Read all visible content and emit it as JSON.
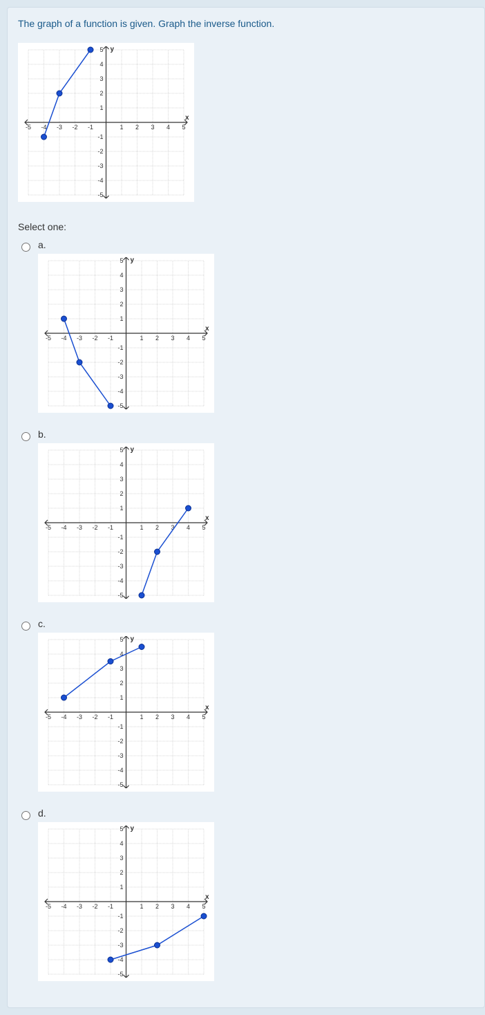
{
  "question": "The graph of a function is given. Graph the inverse function.",
  "select_label": "Select one:",
  "options": {
    "a": "a.",
    "b": "b.",
    "c": "c.",
    "d": "d."
  },
  "chart_data": [
    {
      "type": "line",
      "name": "given",
      "x": [
        -4,
        -3,
        -1
      ],
      "y": [
        -1,
        2,
        5
      ],
      "xlim": [
        -5,
        5
      ],
      "ylim": [
        -5,
        5
      ],
      "xlabel": "x",
      "ylabel": "y"
    },
    {
      "type": "line",
      "name": "option_a",
      "x": [
        -4,
        -3,
        -1
      ],
      "y": [
        1,
        -2,
        -5
      ],
      "xlim": [
        -5,
        5
      ],
      "ylim": [
        -5,
        5
      ],
      "xlabel": "x",
      "ylabel": "y"
    },
    {
      "type": "line",
      "name": "option_b",
      "x": [
        1,
        2,
        4
      ],
      "y": [
        -5,
        -2,
        1
      ],
      "xlim": [
        -5,
        5
      ],
      "ylim": [
        -5,
        5
      ],
      "xlabel": "x",
      "ylabel": "y"
    },
    {
      "type": "line",
      "name": "option_c",
      "x": [
        -4,
        -1,
        1
      ],
      "y": [
        1,
        3.5,
        4.5
      ],
      "xlim": [
        -5,
        5
      ],
      "ylim": [
        -5,
        5
      ],
      "xlabel": "x",
      "ylabel": "y"
    },
    {
      "type": "line",
      "name": "option_d",
      "x": [
        -1,
        2,
        5
      ],
      "y": [
        -4,
        -3,
        -1
      ],
      "xlim": [
        -5,
        5
      ],
      "ylim": [
        -5,
        5
      ],
      "xlabel": "x",
      "ylabel": "y"
    }
  ]
}
